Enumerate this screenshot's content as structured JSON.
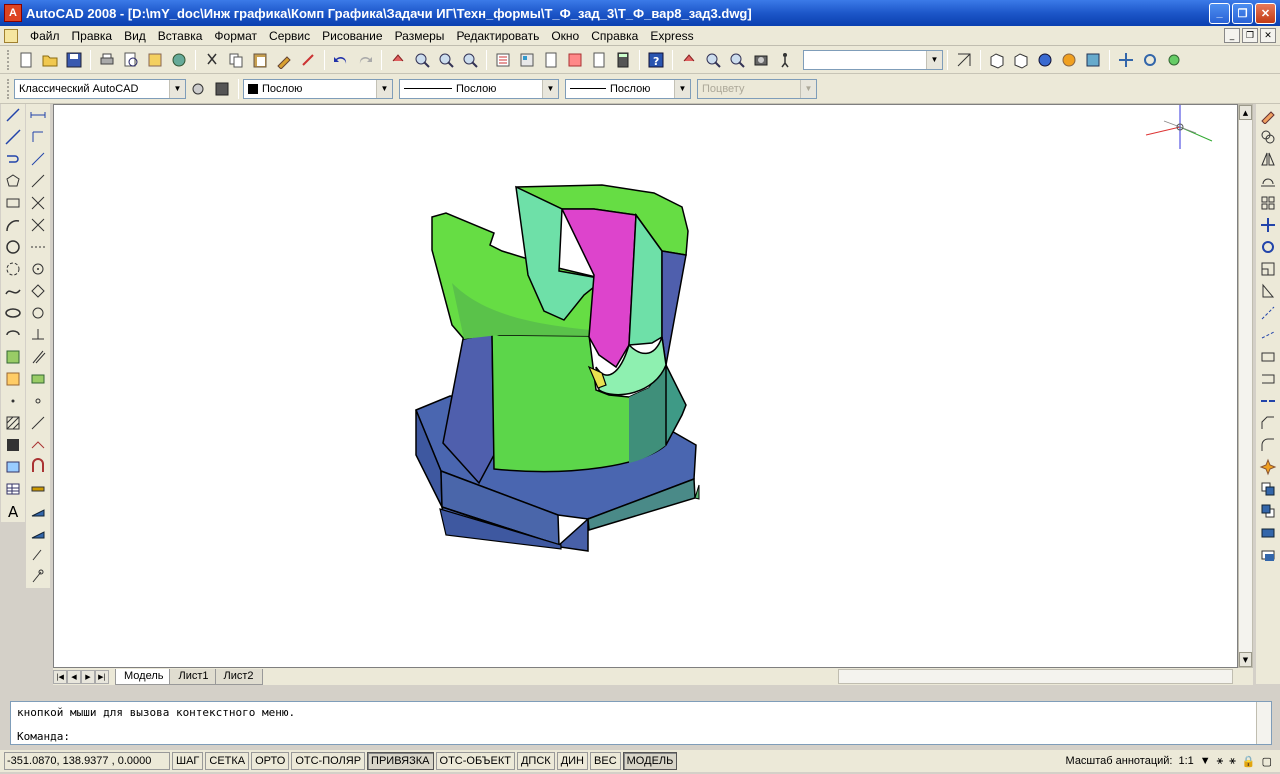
{
  "window": {
    "title": "AutoCAD 2008 - [D:\\mY_doc\\Инж графика\\Комп Графика\\Задачи ИГ\\Техн_формы\\Т_Ф_зад_3\\Т_Ф_вар8_зад3.dwg]",
    "minimize": "_",
    "maximize": "❐",
    "close": "✕"
  },
  "menu": [
    "Файл",
    "Правка",
    "Вид",
    "Вставка",
    "Формат",
    "Сервис",
    "Рисование",
    "Размеры",
    "Редактировать",
    "Окно",
    "Справка",
    "Express"
  ],
  "toolbar2": {
    "workspace": "Классический AutoCAD",
    "color": "Послою",
    "linetype": "Послою",
    "lineweight": "Послою",
    "plotstyle": "Поцвету"
  },
  "tabs": [
    "Модель",
    "Лист1",
    "Лист2"
  ],
  "active_tab": "Модель",
  "command": {
    "history": "кнопкой мыши для вызова контекстного меню.",
    "prompt": "Команда:"
  },
  "status": {
    "coords": "-351.0870, 138.9377 , 0.0000",
    "buttons": [
      {
        "label": "ШАГ",
        "on": false
      },
      {
        "label": "СЕТКА",
        "on": false
      },
      {
        "label": "ОРТО",
        "on": false
      },
      {
        "label": "ОТС-ПОЛЯР",
        "on": false
      },
      {
        "label": "ПРИВЯЗКА",
        "on": true
      },
      {
        "label": "ОТС-ОБЪЕКТ",
        "on": false
      },
      {
        "label": "ДПСК",
        "on": false
      },
      {
        "label": "ДИН",
        "on": false
      },
      {
        "label": "ВЕС",
        "on": false
      },
      {
        "label": "МОДЕЛЬ",
        "on": true
      }
    ],
    "annotation_scale_label": "Масштаб аннотаций:",
    "annotation_scale": "1:1"
  },
  "colors": {
    "green_face": "#66dd44",
    "blue_face": "#4a5fa8",
    "magenta_face": "#dd44cc",
    "mint_face": "#66e0a8"
  }
}
